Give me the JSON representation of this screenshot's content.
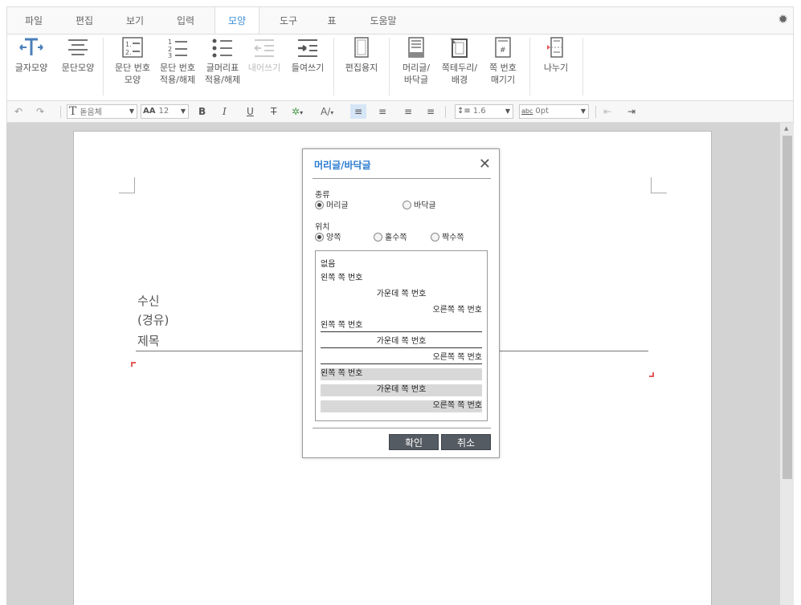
{
  "menu": {
    "tabs": [
      "파일",
      "편집",
      "보기",
      "입력",
      "모양",
      "도구",
      "표",
      "도움말"
    ],
    "active": "모양"
  },
  "ribbon": {
    "char_shape": "글자모양",
    "para_shape": "문단모양",
    "para_num_shape": [
      "문단 번호",
      "모양"
    ],
    "para_num_toggle": [
      "문단 번호",
      "적용/해제"
    ],
    "bullet_toggle": [
      "글머리표",
      "적용/해제"
    ],
    "outdent": "내어쓰기",
    "indent": "들여쓰기",
    "page_setup": "편집용지",
    "header_footer": [
      "머리글/",
      "바닥글"
    ],
    "page_border": [
      "쪽테두리/",
      "배경"
    ],
    "page_number": [
      "쪽 번호",
      "매기기"
    ],
    "split": "나누기"
  },
  "format_bar": {
    "font_name": "돋움체",
    "font_size": "12",
    "bold": "B",
    "italic": "I",
    "underline": "U",
    "strike": "T",
    "line_spacing": "1.6",
    "char_spacing_label": "abc",
    "char_spacing": "0pt"
  },
  "document": {
    "lines": [
      "수신",
      "(경유)",
      "제목"
    ]
  },
  "dialog": {
    "title": "머리글/바닥글",
    "type_label": "종류",
    "type_options": [
      "머리글",
      "바닥글"
    ],
    "type_selected": "머리글",
    "position_label": "위치",
    "position_options": [
      "양쪽",
      "홀수쪽",
      "짝수쪽"
    ],
    "position_selected": "양쪽",
    "list": {
      "none": "없음",
      "left": "왼쪽 쪽 번호",
      "center": "가운데 쪽 번호",
      "right": "오른쪽 쪽 번호"
    },
    "ok": "확인",
    "cancel": "취소"
  },
  "colors": {
    "accent": "#3e8fd8",
    "dialog_title": "#2a7bcf",
    "button": "#555b62",
    "workspace": "#d3d3d3",
    "corner_mark": "#e35a5a"
  }
}
